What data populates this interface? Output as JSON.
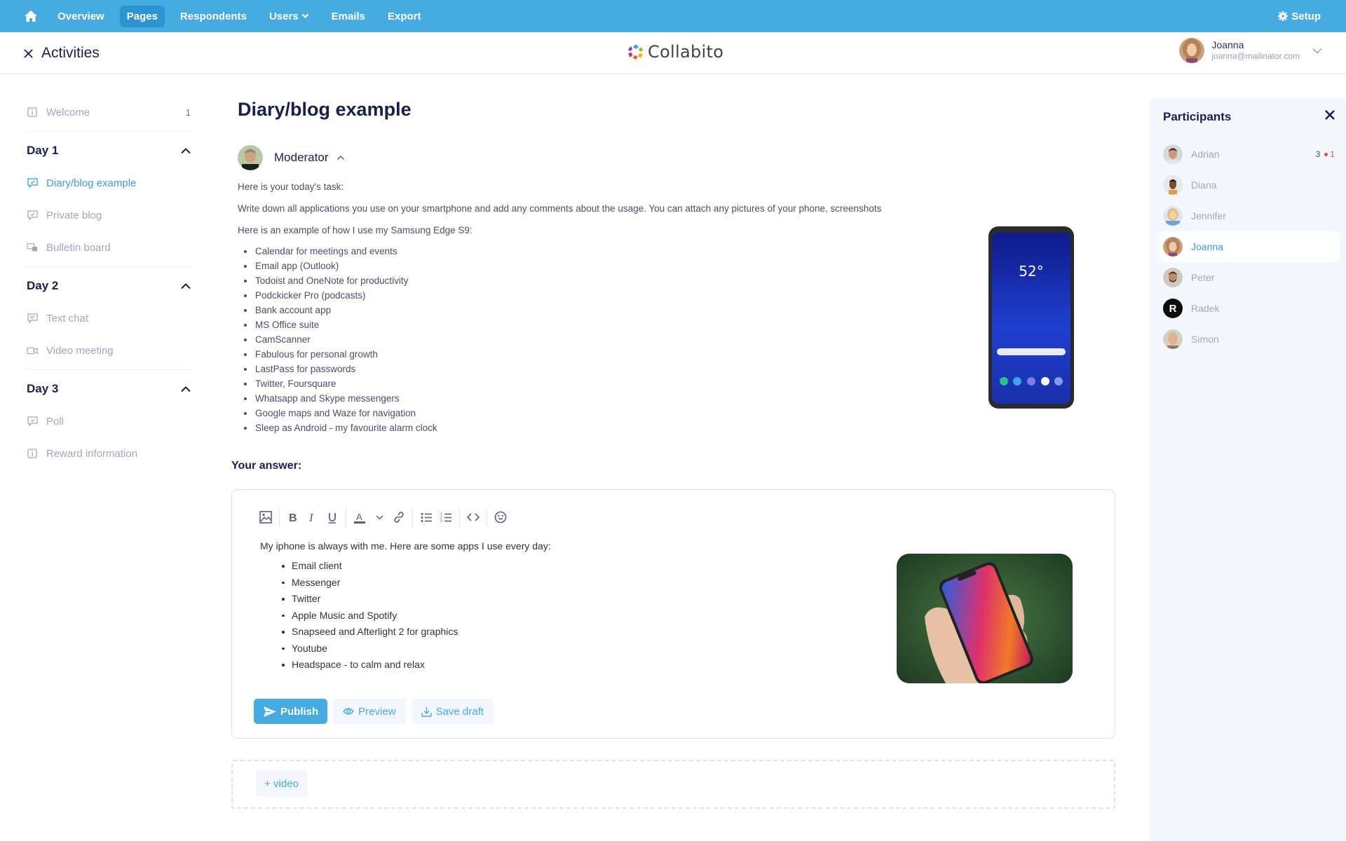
{
  "topnav": {
    "items": [
      {
        "label": "Overview",
        "active": false
      },
      {
        "label": "Pages",
        "active": true
      },
      {
        "label": "Respondents",
        "active": false
      },
      {
        "label": "Users",
        "active": false,
        "dropdown": true
      },
      {
        "label": "Emails",
        "active": false
      },
      {
        "label": "Export",
        "active": false
      }
    ],
    "setup_label": "Setup",
    "colors": {
      "bar": "#45abe0",
      "active": "#2e93d1"
    }
  },
  "header": {
    "close_title": "Activities",
    "brand": "Collabito",
    "user": {
      "name": "Joanna",
      "email": "joanna@mailinator.com"
    }
  },
  "sidebar": {
    "welcome": {
      "label": "Welcome",
      "count": "1",
      "icon": "info-icon"
    },
    "days": [
      {
        "title": "Day 1",
        "items": [
          {
            "label": "Diary/blog example",
            "icon": "blog-icon",
            "active": true
          },
          {
            "label": "Private blog",
            "icon": "blog-icon",
            "active": false
          },
          {
            "label": "Bulletin board",
            "icon": "bulletin-icon",
            "active": false
          }
        ]
      },
      {
        "title": "Day 2",
        "items": [
          {
            "label": "Text chat",
            "icon": "chat-icon",
            "active": false
          },
          {
            "label": "Video meeting",
            "icon": "video-icon",
            "active": false
          }
        ]
      },
      {
        "title": "Day 3",
        "items": [
          {
            "label": "Poll",
            "icon": "poll-icon",
            "active": false
          },
          {
            "label": "Reward information",
            "icon": "info-icon",
            "active": false
          }
        ]
      }
    ]
  },
  "main": {
    "title": "Diary/blog example",
    "moderator": "Moderator",
    "post": {
      "paragraphs": [
        "Here is your today's task:",
        "Write down all applications you use on your smartphone and add any comments about the usage. You can attach any pictures of your phone, screenshots",
        "Here is an example of how I use my Samsung Edge S9:"
      ],
      "list": [
        "Calendar for meetings and events",
        "Email app (Outlook)",
        "Todoist and OneNote for productivity",
        "Podckicker Pro (podcasts)",
        "Bank account app",
        "MS Office suite",
        "CamScanner",
        "Fabulous for personal growth",
        "LastPass for passwords",
        "Twitter, Foursquare",
        "Whatsapp and Skype messengers",
        "Google maps and Waze for navigation",
        "Sleep as Android - my favourite alarm clock"
      ],
      "phone_screen": {
        "temperature": "52°"
      }
    },
    "answer_label": "Your answer:",
    "editor": {
      "toolbar": [
        "image-icon",
        "bold-icon",
        "italic-icon",
        "underline-icon",
        "text-color-icon",
        "chevron-down-icon",
        "link-icon",
        "bullet-list-icon",
        "numbered-list-icon",
        "code-icon",
        "emoji-icon"
      ],
      "intro": "My iphone is always with me. Here are some apps I use every day:",
      "list": [
        "Email client",
        "Messenger",
        "Twitter",
        "Apple Music and Spotify",
        "Snapseed and Afterlight 2 for graphics",
        "Youtube",
        "Headspace - to calm and relax"
      ],
      "publish_label": "Publish",
      "preview_label": "Preview",
      "save_draft_label": "Save draft"
    },
    "add_video_label": "+ video"
  },
  "participants": {
    "title": "Participants",
    "list": [
      {
        "name": "Adrian",
        "count": "3",
        "unread": "1",
        "active": false
      },
      {
        "name": "Diana",
        "active": false
      },
      {
        "name": "Jennifer",
        "active": false
      },
      {
        "name": "Joanna",
        "active": true
      },
      {
        "name": "Peter",
        "active": false
      },
      {
        "name": "Radek",
        "initial": "R",
        "active": false
      },
      {
        "name": "Simon",
        "active": false
      }
    ]
  }
}
